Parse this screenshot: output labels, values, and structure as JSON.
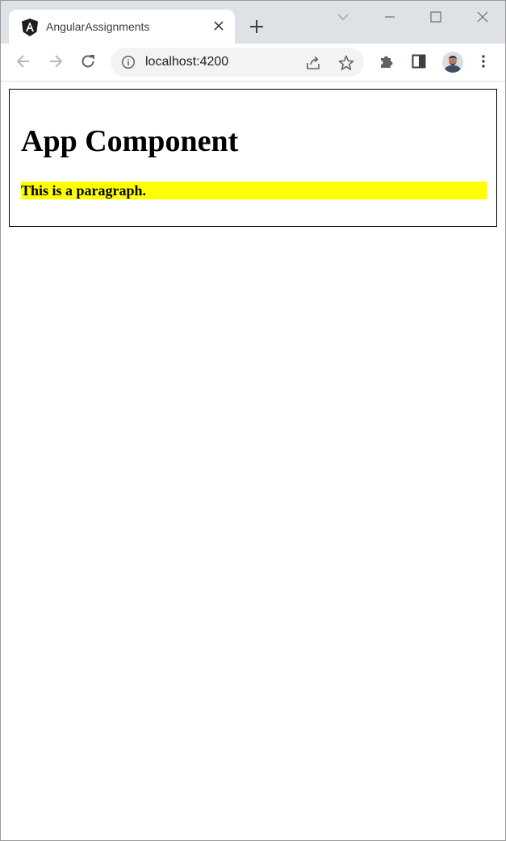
{
  "browser": {
    "tab": {
      "title": "AngularAssignments",
      "favicon": "angular-logo-icon"
    },
    "address_bar": {
      "url": "localhost:4200"
    }
  },
  "page": {
    "heading": "App Component",
    "paragraph": "This is a paragraph.",
    "paragraph_highlight_color": "#ffff00"
  }
}
